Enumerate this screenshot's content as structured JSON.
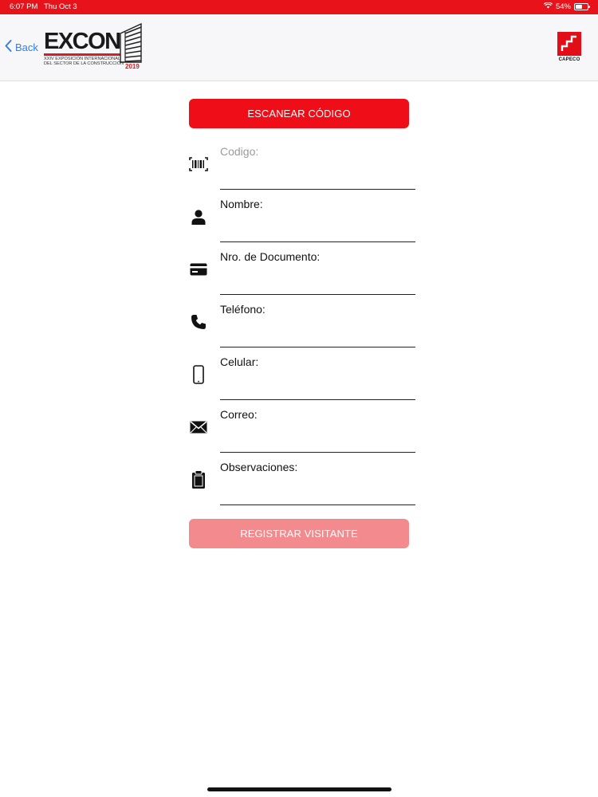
{
  "status_bar": {
    "time": "6:07 PM",
    "date": "Thu Oct 3",
    "battery_text": "54%",
    "battery_level": 0.54
  },
  "nav": {
    "back_label": "Back",
    "logo": {
      "word": "EXCON",
      "subtitle_line1": "XXIV EXPOSICIÓN INTERNACIONAL",
      "subtitle_line2": "DEL SECTOR DE LA CONSTRUCCIÓN",
      "year": "2019"
    },
    "partner_logo_text": "CAPECO"
  },
  "form": {
    "scan_button": "ESCANEAR CÓDIGO",
    "fields": [
      {
        "label": "Codigo:",
        "icon": "barcode-icon",
        "placeholder": true
      },
      {
        "label": "Nombre:",
        "icon": "person-icon",
        "placeholder": false
      },
      {
        "label": "Nro. de Documento:",
        "icon": "id-card-icon",
        "placeholder": false
      },
      {
        "label": "Teléfono:",
        "icon": "phone-icon",
        "placeholder": false
      },
      {
        "label": "Celular:",
        "icon": "mobile-icon",
        "placeholder": false
      },
      {
        "label": "Correo:",
        "icon": "mail-icon",
        "placeholder": false
      },
      {
        "label": "Observaciones:",
        "icon": "clipboard-icon",
        "placeholder": false
      }
    ],
    "register_button": "REGISTRAR VISITANTE"
  },
  "colors": {
    "accent": "#ef0d17",
    "accent_disabled": "#f28a8e",
    "link": "#2f80ed"
  }
}
